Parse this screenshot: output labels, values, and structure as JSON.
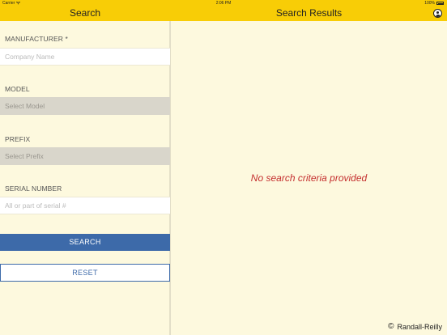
{
  "status_bar": {
    "carrier": "Carrier",
    "time": "2:06 PM",
    "battery": "100%"
  },
  "nav": {
    "left_title": "Search",
    "right_title": "Search Results"
  },
  "form": {
    "manufacturer": {
      "label": "MANUFACTURER *",
      "placeholder": "Company Name"
    },
    "model": {
      "label": "MODEL",
      "value": "Select Model"
    },
    "prefix": {
      "label": "PREFIX",
      "value": "Select Prefix"
    },
    "serial": {
      "label": "SERIAL NUMBER",
      "placeholder": "All or part of serial #"
    },
    "search_label": "SEARCH",
    "reset_label": "RESET"
  },
  "results": {
    "empty_message": "No search criteria provided"
  },
  "footer": {
    "copyright_symbol": "©",
    "company": "Randall-Reilly"
  },
  "colors": {
    "nav_background": "#f8cd06",
    "page_background": "#fdf9de",
    "primary_blue": "#3d6aa9",
    "message_red": "#c42e2e"
  },
  "icons": {
    "wifi": "wifi-icon",
    "battery": "battery-icon",
    "profile": "profile-icon"
  }
}
